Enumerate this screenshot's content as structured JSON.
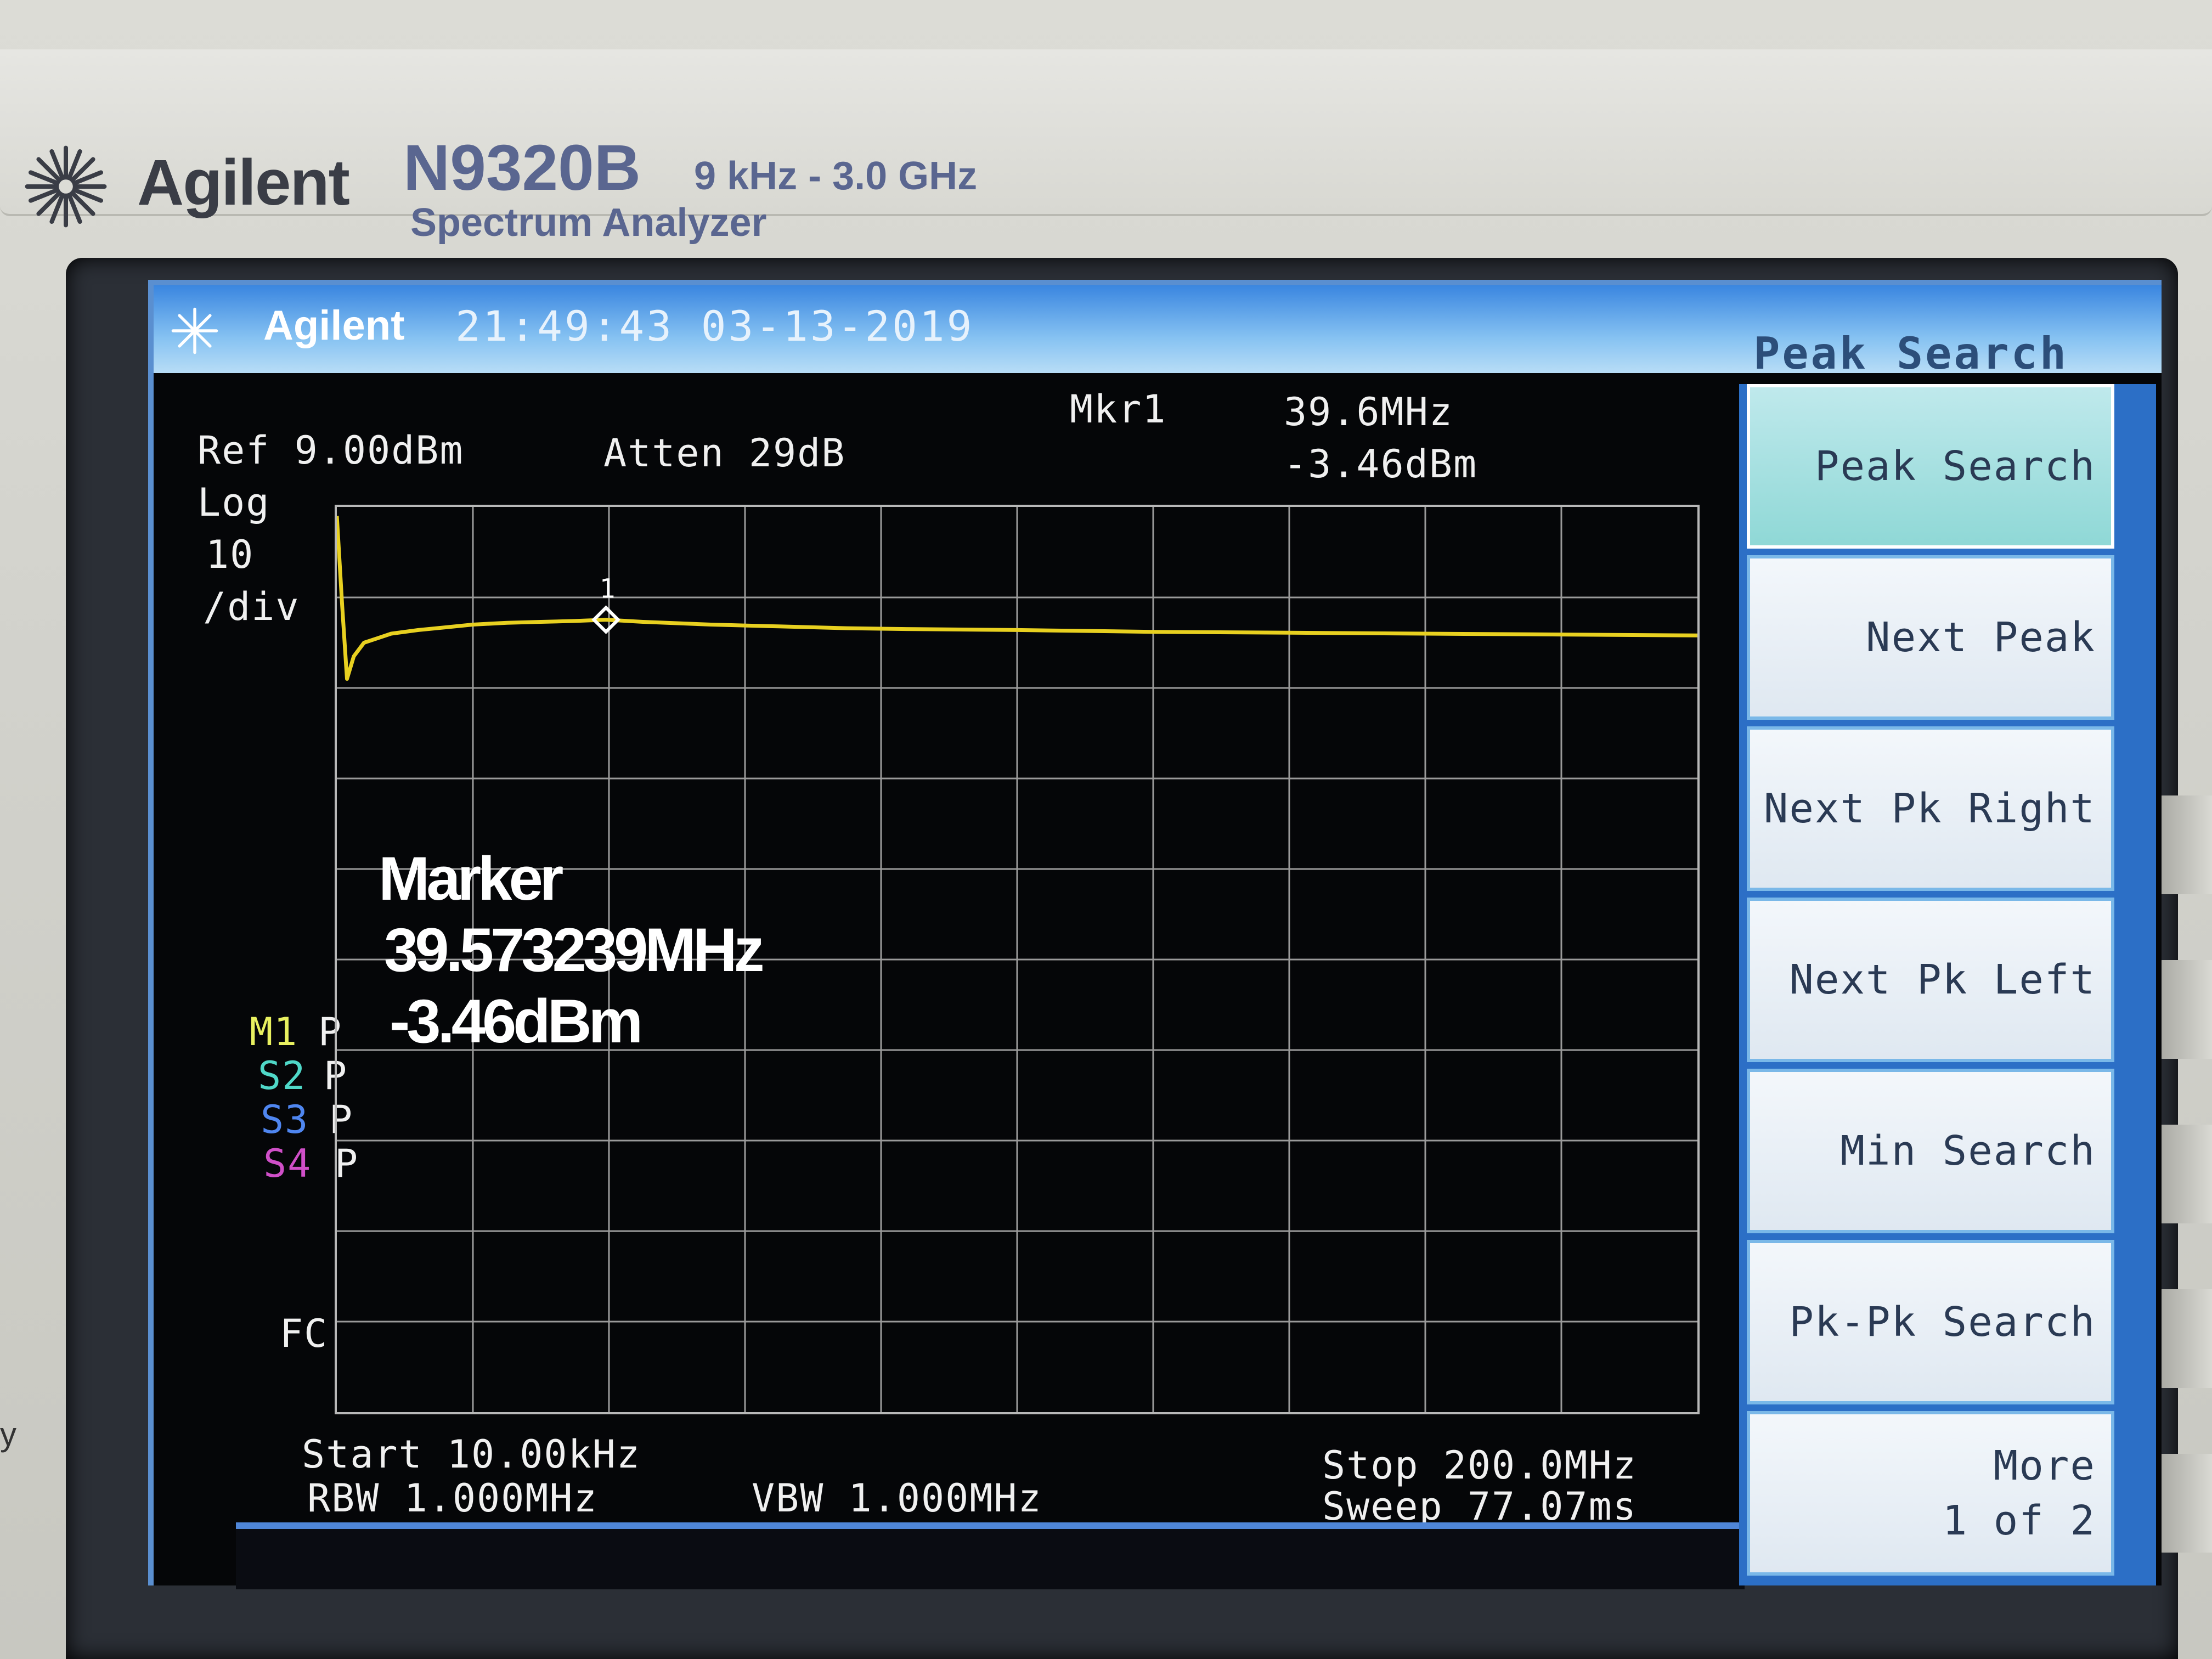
{
  "instrument": {
    "brand": "Agilent",
    "model": "N9320B",
    "range": "9 kHz - 3.0 GHz",
    "description": "Spectrum Analyzer",
    "left_caption": "y"
  },
  "titlebar": {
    "brand": "Agilent",
    "datetime": "21:49:43 03-13-2019",
    "menu_title": "Peak Search"
  },
  "readouts": {
    "ref": "Ref 9.00dBm",
    "atten": "Atten 29dB",
    "mkr_label": "Mkr1",
    "mkr_freq": "39.6MHz",
    "mkr_amp": "-3.46dBm",
    "scale_type": "Log",
    "scale_value": "10",
    "scale_unit": "/div",
    "fc": "FC",
    "start": "Start 10.00kHz",
    "stop": "Stop 200.0MHz",
    "rbw": "RBW 1.000MHz",
    "vbw": "VBW 1.000MHz",
    "sweep": "Sweep 77.07ms"
  },
  "markers": [
    {
      "id": "M1",
      "mode": "P",
      "color": "#e8f060"
    },
    {
      "id": "S2",
      "mode": "P",
      "color": "#4fd8c8"
    },
    {
      "id": "S3",
      "mode": "P",
      "color": "#4f86f0"
    },
    {
      "id": "S4",
      "mode": "P",
      "color": "#d04fc8"
    }
  ],
  "marker_overlay": {
    "title": "Marker",
    "frequency": "39.573239MHz",
    "amplitude": "-3.46dBm"
  },
  "marker_point": {
    "label": "1"
  },
  "softkeys": [
    {
      "label": "Peak Search",
      "active": true
    },
    {
      "label": "Next Peak",
      "active": false
    },
    {
      "label": "Next Pk Right",
      "active": false
    },
    {
      "label": "Next Pk Left",
      "active": false
    },
    {
      "label": "Min Search",
      "active": false
    },
    {
      "label": "Pk-Pk Search",
      "active": false
    },
    {
      "label": "More\n1 of 2",
      "active": false
    }
  ],
  "chart_data": {
    "type": "line",
    "x_unit": "MHz",
    "y_unit": "dBm",
    "xlim": [
      0.01,
      200.0
    ],
    "ylim": [
      -91.0,
      9.0
    ],
    "grid": true,
    "trace_color": "#e8d020",
    "series": [
      {
        "x": [
          0.01,
          0.8,
          1.5,
          2.5,
          4,
          6,
          8,
          12,
          16,
          20,
          25,
          30,
          35,
          39.57,
          45,
          55,
          65,
          75,
          85,
          100,
          120,
          140,
          160,
          180,
          200
        ],
        "y": [
          8.0,
          -2.0,
          -10.0,
          -7.5,
          -6.0,
          -5.5,
          -5.0,
          -4.6,
          -4.3,
          -4.0,
          -3.8,
          -3.7,
          -3.6,
          -3.46,
          -3.7,
          -4.0,
          -4.2,
          -4.4,
          -4.5,
          -4.6,
          -4.8,
          -4.9,
          -5.0,
          -5.1,
          -5.2
        ]
      }
    ],
    "marker": {
      "x": 39.57,
      "y": -3.46
    }
  }
}
